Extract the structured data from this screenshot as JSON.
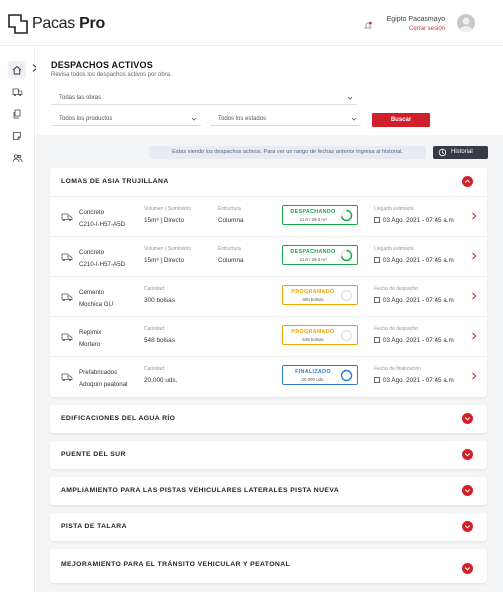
{
  "app": {
    "brand_light": "Pacas",
    "brand_bold": "Pro"
  },
  "user": {
    "name": "Egipto Pacasmayo",
    "logout": "Cerrar sesión"
  },
  "page": {
    "title": "DESPACHOS ACTIVOS",
    "subtitle": "Revisa todos los despachos activos por obra."
  },
  "filters": {
    "obras": "Todas las obras",
    "productos": "Todos los productos",
    "estados": "Todos los estados",
    "search_label": "Buscar"
  },
  "notice": "Estas viendo los despachos activos. Para ver un rango de fechas anterior ingresa al historial.",
  "history_label": "Historial",
  "colors": {
    "accent": "#d0212a",
    "despachando": "#1aa64a",
    "programado": "#f0a500",
    "finalizado": "#2f7dd1"
  },
  "expanded_project": {
    "title": "LOMAS DE ASIA TRUJILLANA",
    "rows": [
      {
        "icon": "truck-icon",
        "product": "Concreto",
        "code": "C210-I-H57-A5D",
        "m1_label": "Volumen | Suministro",
        "m1_value": "15m³ | Directo",
        "m2_label": "Estructura",
        "m2_value": "Columna",
        "status": "DESPACHANDO",
        "status_detail": "21.0 / 29.0 m³",
        "status_color": "#1aa64a",
        "progress": 0.72,
        "date_label": "Llegada estimada",
        "date": "03 Ago. 2021 - 07:45 a.m"
      },
      {
        "icon": "truck-icon",
        "product": "Concreto",
        "code": "C210-I-H57-A5D",
        "m1_label": "Volumen | Suministro",
        "m1_value": "15m³ | Directo",
        "m2_label": "Estructura",
        "m2_value": "Columna",
        "status": "DESPACHANDO",
        "status_detail": "21.0 / 29.0 m³",
        "status_color": "#1aa64a",
        "progress": 0.72,
        "date_label": "Llegada estimada",
        "date": "03 Ago. 2021 - 07:45 a.m"
      },
      {
        "icon": "truck-icon",
        "product": "Cemento",
        "code": "Mochica GU",
        "m1_label": "Cantidad",
        "m1_value": "300 bolsas",
        "m2_label": "",
        "m2_value": "",
        "status": "PROGRAMADO",
        "status_detail": "300 bolsas",
        "status_color": "#f0a500",
        "progress": 0,
        "date_label": "Fecha de despacho",
        "date": "03 Ago. 2021 - 07:45 a.m"
      },
      {
        "icon": "truck-icon",
        "product": "Repimix",
        "code": "Mortero",
        "m1_label": "Cantidad",
        "m1_value": "548 bolsas",
        "m2_label": "",
        "m2_value": "",
        "status": "PROGRAMADO",
        "status_detail": "548 bolsas",
        "status_color": "#f0a500",
        "progress": 0,
        "date_label": "Fecha de despacho",
        "date": "03 Ago. 2021 - 07:45 a.m"
      },
      {
        "icon": "truck-icon",
        "product": "Prefabricados",
        "code": "Adoquín peatonal",
        "m1_label": "Cantidad",
        "m1_value": "20,000 uds.",
        "m2_label": "",
        "m2_value": "",
        "status": "FINALIZADO",
        "status_detail": "20,000 uds.",
        "status_color": "#2f7dd1",
        "progress": 1,
        "date_label": "Fecha de finalización",
        "date": "03 Ago. 2021 - 07:45 a.m"
      }
    ]
  },
  "collapsed_projects": [
    "EDIFICACIONES DEL AGUA RÍO",
    "PUENTE DEL SUR",
    "AMPLIAMIENTO PARA LAS PISTAS VEHICULARES LATERALES PISTA NUEVA",
    "PISTA DE TALARA",
    "MEJORAMIENTO PARA EL TRÁNSITO VEHICULAR Y PEATONAL"
  ]
}
